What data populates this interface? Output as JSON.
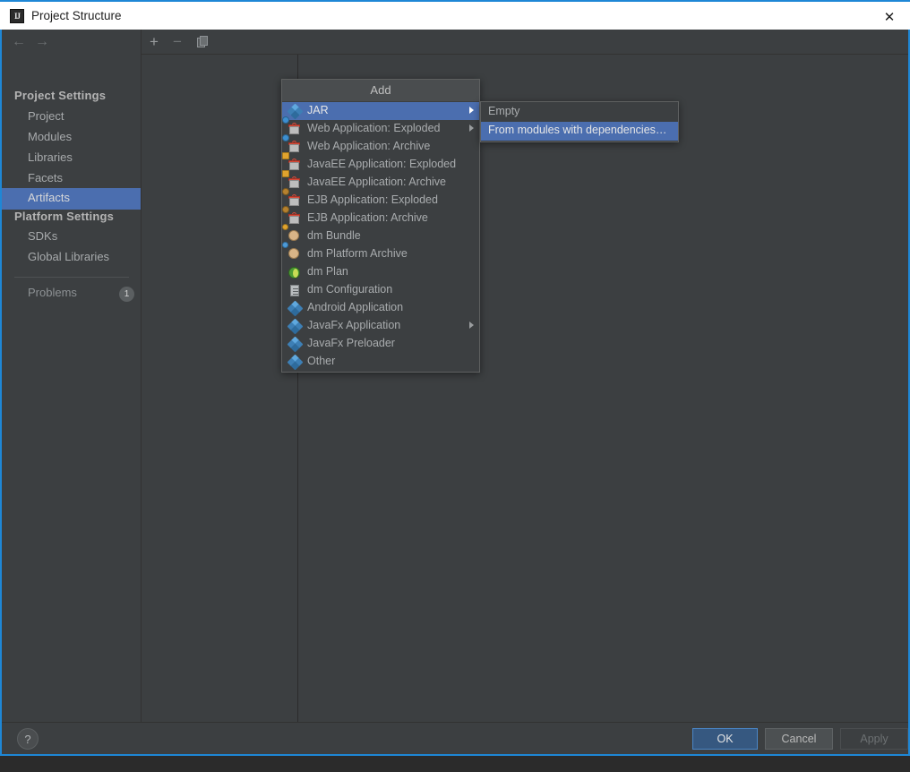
{
  "window": {
    "title": "Project Structure",
    "app_icon": "intellij-idea-icon",
    "close_label": "✕"
  },
  "sidebar": {
    "nav": {
      "back": "←",
      "forward": "→"
    },
    "groups": [
      {
        "label": "Project Settings"
      },
      {
        "label": "Platform Settings"
      }
    ],
    "project_settings_items": [
      {
        "label": "Project",
        "selected": false
      },
      {
        "label": "Modules",
        "selected": false
      },
      {
        "label": "Libraries",
        "selected": false
      },
      {
        "label": "Facets",
        "selected": false
      },
      {
        "label": "Artifacts",
        "selected": true
      }
    ],
    "platform_settings_items": [
      {
        "label": "SDKs",
        "selected": false
      },
      {
        "label": "Global Libraries",
        "selected": false
      }
    ],
    "problems": {
      "label": "Problems",
      "count": "1"
    }
  },
  "toolbar": {
    "add_label": "+",
    "remove_label": "−",
    "copy_label": "copy-icon"
  },
  "add_menu": {
    "title": "Add",
    "items": [
      {
        "label": "JAR",
        "icon": "jar-icon",
        "submenu": true,
        "selected": true
      },
      {
        "label": "Web Application: Exploded",
        "icon": "gift-blue-icon",
        "submenu": true,
        "selected": false
      },
      {
        "label": "Web Application: Archive",
        "icon": "gift-blue-icon",
        "submenu": false,
        "selected": false
      },
      {
        "label": "JavaEE Application: Exploded",
        "icon": "gift-gold-icon",
        "submenu": false,
        "selected": false
      },
      {
        "label": "JavaEE Application: Archive",
        "icon": "gift-gold-icon",
        "submenu": false,
        "selected": false
      },
      {
        "label": "EJB Application: Exploded",
        "icon": "gift-bean-icon",
        "submenu": false,
        "selected": false
      },
      {
        "label": "EJB Application: Archive",
        "icon": "gift-bean-icon",
        "submenu": false,
        "selected": false
      },
      {
        "label": "dm Bundle",
        "icon": "bundle-icon",
        "submenu": false,
        "selected": false
      },
      {
        "label": "dm Platform Archive",
        "icon": "bundle-blue-icon",
        "submenu": false,
        "selected": false
      },
      {
        "label": "dm Plan",
        "icon": "globe-icon",
        "submenu": false,
        "selected": false
      },
      {
        "label": "dm Configuration",
        "icon": "document-icon",
        "submenu": false,
        "selected": false
      },
      {
        "label": "Android Application",
        "icon": "jar-icon",
        "submenu": false,
        "selected": false
      },
      {
        "label": "JavaFx Application",
        "icon": "jar-icon",
        "submenu": true,
        "selected": false
      },
      {
        "label": "JavaFx Preloader",
        "icon": "jar-icon",
        "submenu": false,
        "selected": false
      },
      {
        "label": "Other",
        "icon": "jar-icon",
        "submenu": false,
        "selected": false
      }
    ]
  },
  "sub_menu": {
    "items": [
      {
        "label": "Empty",
        "selected": false
      },
      {
        "label": "From modules with dependencies…",
        "selected": true
      }
    ]
  },
  "footer": {
    "help_label": "?",
    "ok_label": "OK",
    "cancel_label": "Cancel",
    "apply_label": "Apply"
  },
  "colors": {
    "accent_blue": "#4b6eaf",
    "ok_blue": "#365880",
    "window_border": "#1e87d6",
    "panel_bg": "#3c3f41",
    "desktop_bg": "#2b2b2b"
  }
}
